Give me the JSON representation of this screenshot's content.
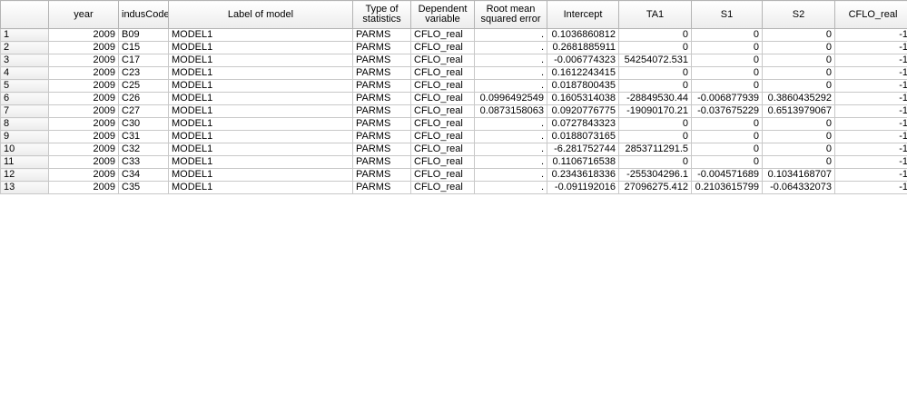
{
  "columns": [
    {
      "key": "year",
      "label": "year",
      "align": "num"
    },
    {
      "key": "indusCode",
      "label": "indusCode",
      "align": "txt"
    },
    {
      "key": "label",
      "label": "Label of model",
      "align": "txt"
    },
    {
      "key": "type",
      "label": "Type of statistics",
      "align": "txt"
    },
    {
      "key": "depvar",
      "label": "Dependent variable",
      "align": "txt"
    },
    {
      "key": "rmse",
      "label": "Root mean squared error",
      "align": "num"
    },
    {
      "key": "intercept",
      "label": "Intercept",
      "align": "num"
    },
    {
      "key": "ta1",
      "label": "TA1",
      "align": "num"
    },
    {
      "key": "s1",
      "label": "S1",
      "align": "num"
    },
    {
      "key": "s2",
      "label": "S2",
      "align": "num"
    },
    {
      "key": "cflo",
      "label": "CFLO_real",
      "align": "num"
    }
  ],
  "rows": [
    {
      "n": "1",
      "year": "2009",
      "indusCode": "B09",
      "label": "MODEL1",
      "type": "PARMS",
      "depvar": "CFLO_real",
      "rmse": ".",
      "intercept": "0.1036860812",
      "ta1": "0",
      "s1": "0",
      "s2": "0",
      "cflo": "-1"
    },
    {
      "n": "2",
      "year": "2009",
      "indusCode": "C15",
      "label": "MODEL1",
      "type": "PARMS",
      "depvar": "CFLO_real",
      "rmse": ".",
      "intercept": "0.2681885911",
      "ta1": "0",
      "s1": "0",
      "s2": "0",
      "cflo": "-1"
    },
    {
      "n": "3",
      "year": "2009",
      "indusCode": "C17",
      "label": "MODEL1",
      "type": "PARMS",
      "depvar": "CFLO_real",
      "rmse": ".",
      "intercept": "-0.006774323",
      "ta1": "54254072.531",
      "s1": "0",
      "s2": "0",
      "cflo": "-1"
    },
    {
      "n": "4",
      "year": "2009",
      "indusCode": "C23",
      "label": "MODEL1",
      "type": "PARMS",
      "depvar": "CFLO_real",
      "rmse": ".",
      "intercept": "0.1612243415",
      "ta1": "0",
      "s1": "0",
      "s2": "0",
      "cflo": "-1"
    },
    {
      "n": "5",
      "year": "2009",
      "indusCode": "C25",
      "label": "MODEL1",
      "type": "PARMS",
      "depvar": "CFLO_real",
      "rmse": ".",
      "intercept": "0.0187800435",
      "ta1": "0",
      "s1": "0",
      "s2": "0",
      "cflo": "-1"
    },
    {
      "n": "6",
      "year": "2009",
      "indusCode": "C26",
      "label": "MODEL1",
      "type": "PARMS",
      "depvar": "CFLO_real",
      "rmse": "0.0996492549",
      "intercept": "0.1605314038",
      "ta1": "-28849530.44",
      "s1": "-0.006877939",
      "s2": "0.3860435292",
      "cflo": "-1"
    },
    {
      "n": "7",
      "year": "2009",
      "indusCode": "C27",
      "label": "MODEL1",
      "type": "PARMS",
      "depvar": "CFLO_real",
      "rmse": "0.0873158063",
      "intercept": "0.0920776775",
      "ta1": "-19090170.21",
      "s1": "-0.037675229",
      "s2": "0.6513979067",
      "cflo": "-1"
    },
    {
      "n": "8",
      "year": "2009",
      "indusCode": "C30",
      "label": "MODEL1",
      "type": "PARMS",
      "depvar": "CFLO_real",
      "rmse": ".",
      "intercept": "0.0727843323",
      "ta1": "0",
      "s1": "0",
      "s2": "0",
      "cflo": "-1"
    },
    {
      "n": "9",
      "year": "2009",
      "indusCode": "C31",
      "label": "MODEL1",
      "type": "PARMS",
      "depvar": "CFLO_real",
      "rmse": ".",
      "intercept": "0.0188073165",
      "ta1": "0",
      "s1": "0",
      "s2": "0",
      "cflo": "-1"
    },
    {
      "n": "10",
      "year": "2009",
      "indusCode": "C32",
      "label": "MODEL1",
      "type": "PARMS",
      "depvar": "CFLO_real",
      "rmse": ".",
      "intercept": "-6.281752744",
      "ta1": "2853711291.5",
      "s1": "0",
      "s2": "0",
      "cflo": "-1"
    },
    {
      "n": "11",
      "year": "2009",
      "indusCode": "C33",
      "label": "MODEL1",
      "type": "PARMS",
      "depvar": "CFLO_real",
      "rmse": ".",
      "intercept": "0.1106716538",
      "ta1": "0",
      "s1": "0",
      "s2": "0",
      "cflo": "-1"
    },
    {
      "n": "12",
      "year": "2009",
      "indusCode": "C34",
      "label": "MODEL1",
      "type": "PARMS",
      "depvar": "CFLO_real",
      "rmse": ".",
      "intercept": "0.2343618336",
      "ta1": "-255304296.1",
      "s1": "-0.004571689",
      "s2": "0.1034168707",
      "cflo": "-1"
    },
    {
      "n": "13",
      "year": "2009",
      "indusCode": "C35",
      "label": "MODEL1",
      "type": "PARMS",
      "depvar": "CFLO_real",
      "rmse": ".",
      "intercept": "-0.091192016",
      "ta1": "27096275.412",
      "s1": "0.2103615799",
      "s2": "-0.064332073",
      "cflo": "-1"
    }
  ]
}
